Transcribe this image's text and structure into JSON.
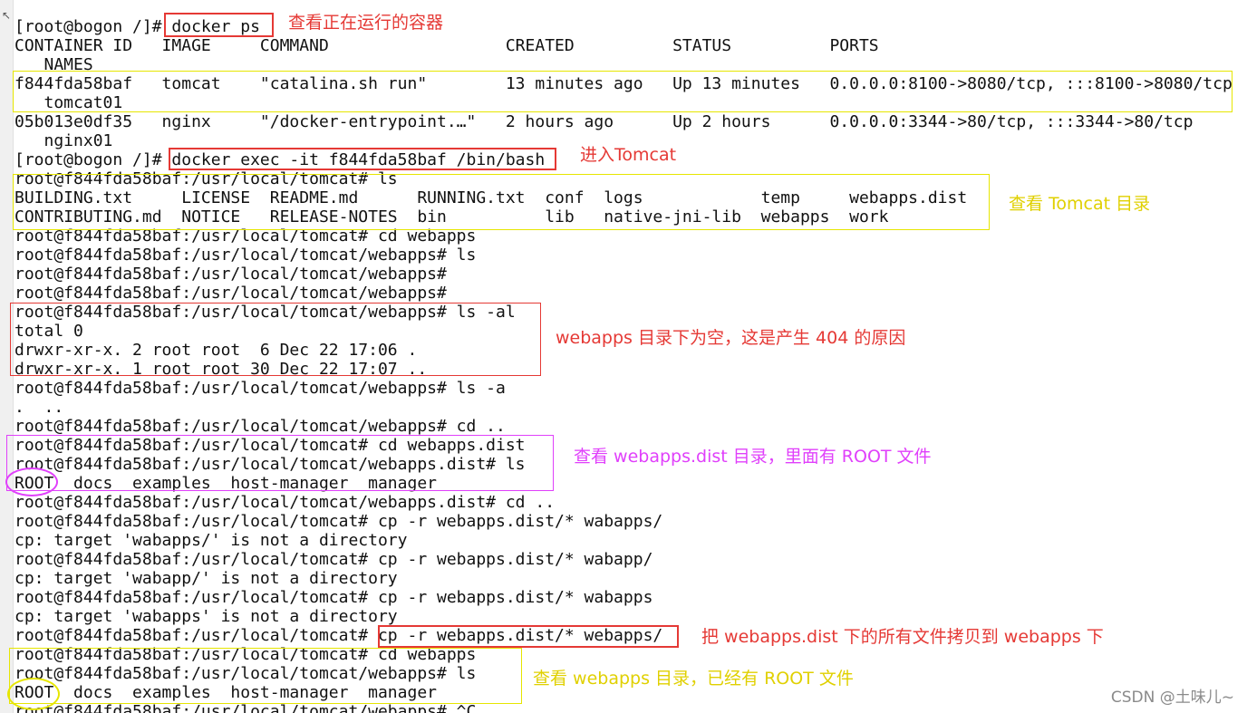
{
  "terminal": {
    "lines": [
      "[root@bogon /]# docker ps",
      "CONTAINER ID   IMAGE     COMMAND                  CREATED          STATUS          PORTS",
      "   NAMES",
      "f844fda58baf   tomcat    \"catalina.sh run\"        13 minutes ago   Up 13 minutes   0.0.0.0:8100->8080/tcp, :::8100->8080/tcp",
      "   tomcat01",
      "05b013e0df35   nginx     \"/docker-entrypoint.…\"   2 hours ago      Up 2 hours      0.0.0.0:3344->80/tcp, :::3344->80/tcp",
      "   nginx01",
      "[root@bogon /]# docker exec -it f844fda58baf /bin/bash",
      "root@f844fda58baf:/usr/local/tomcat# ls",
      "BUILDING.txt     LICENSE  README.md      RUNNING.txt  conf  logs            temp     webapps.dist",
      "CONTRIBUTING.md  NOTICE   RELEASE-NOTES  bin          lib   native-jni-lib  webapps  work",
      "root@f844fda58baf:/usr/local/tomcat# cd webapps",
      "root@f844fda58baf:/usr/local/tomcat/webapps# ls",
      "root@f844fda58baf:/usr/local/tomcat/webapps#",
      "root@f844fda58baf:/usr/local/tomcat/webapps#",
      "root@f844fda58baf:/usr/local/tomcat/webapps# ls -al",
      "total 0",
      "drwxr-xr-x. 2 root root  6 Dec 22 17:06 .",
      "drwxr-xr-x. 1 root root 30 Dec 22 17:07 ..",
      "root@f844fda58baf:/usr/local/tomcat/webapps# ls -a",
      ".  ..",
      "root@f844fda58baf:/usr/local/tomcat/webapps# cd ..",
      "root@f844fda58baf:/usr/local/tomcat# cd webapps.dist",
      "root@f844fda58baf:/usr/local/tomcat/webapps.dist# ls",
      "ROOT  docs  examples  host-manager  manager",
      "root@f844fda58baf:/usr/local/tomcat/webapps.dist# cd ..",
      "root@f844fda58baf:/usr/local/tomcat# cp -r webapps.dist/* wabapps/",
      "cp: target 'wabapps/' is not a directory",
      "root@f844fda58baf:/usr/local/tomcat# cp -r webapps.dist/* wabapp/",
      "cp: target 'wabapp/' is not a directory",
      "root@f844fda58baf:/usr/local/tomcat# cp -r webapps.dist/* wabapps",
      "cp: target 'wabapps' is not a directory",
      "root@f844fda58baf:/usr/local/tomcat# cp -r webapps.dist/* webapps/",
      "root@f844fda58baf:/usr/local/tomcat# cd webapps",
      "root@f844fda58baf:/usr/local/tomcat/webapps# ls",
      "ROOT  docs  examples  host-manager  manager",
      "root@f844fda58baf:/usr/local/tomcat/webapps# ^C"
    ]
  },
  "annotations": {
    "docker_ps": "查看正在运行的容器",
    "enter_tomcat": "进入Tomcat",
    "view_tomcat_dir": "查看 Tomcat 目录",
    "webapps_empty": "webapps 目录下为空，这是产生 404 的原因",
    "view_webapps_dist": "查看 webapps.dist 目录，里面有 ROOT 文件",
    "copy_files": "把 webapps.dist 下的所有文件拷贝到 webapps 下",
    "view_webapps_root": "查看 webapps 目录，已经有 ROOT 文件"
  },
  "watermark": "CSDN @土味儿~",
  "colors": {
    "red": "#e53935",
    "yellow": "#e6e600",
    "magenta": "#e040fb",
    "text": "#111111"
  }
}
